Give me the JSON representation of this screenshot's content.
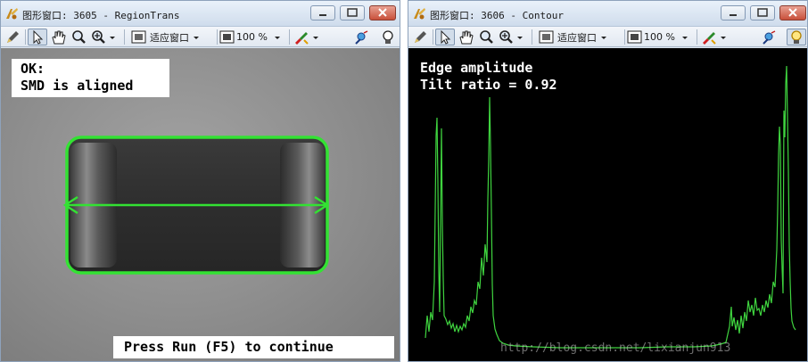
{
  "left_window": {
    "title": "图形窗口: 3605 - RegionTrans",
    "toolbar": {
      "fit_label": "适应窗口",
      "zoom_label": "100 %"
    },
    "message_lines": [
      "OK:",
      "SMD is aligned"
    ],
    "continue_prompt": "Press Run (F5) to continue"
  },
  "right_window": {
    "title": "图形窗口: 3606 - Contour",
    "toolbar": {
      "fit_label": "适应窗口",
      "zoom_label": "100 %"
    },
    "overlay_lines": [
      "Edge amplitude",
      "Tilt ratio = 0.92"
    ],
    "watermark": "http://blog.csdn.net/lixianjun913"
  },
  "colors": {
    "contour_green": "#33e233",
    "plot_green": "#3fd43f",
    "close_button": "#c9503a"
  }
}
